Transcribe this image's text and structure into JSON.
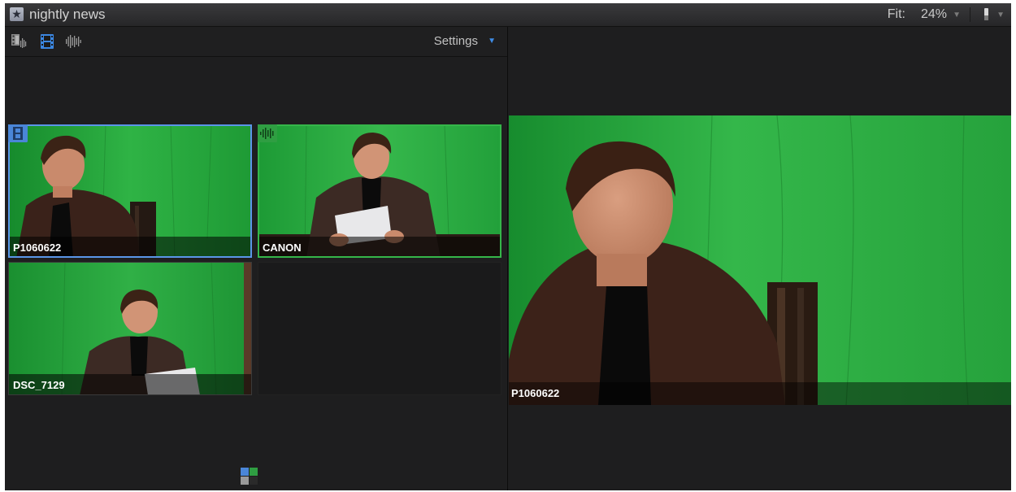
{
  "window": {
    "title": "nightly news",
    "title_icon": "star-icon"
  },
  "viewer_controls": {
    "fit_label": "Fit:",
    "fit_value": "24%",
    "view_options_icon": "viewer-display-icon"
  },
  "angle_viewer": {
    "toolbar": {
      "icons": [
        "video-audio-switch-icon",
        "video-only-switch-icon",
        "audio-only-switch-icon"
      ],
      "settings_label": "Settings"
    },
    "angles": [
      {
        "label": "P1060622",
        "active_badge": "film-icon",
        "border_color": "#5a96e8"
      },
      {
        "label": "CANON",
        "active_badge": "waveform-icon",
        "border_color": "#35b64a"
      },
      {
        "label": "DSC_7129"
      }
    ],
    "bank_icon": "angle-bank-icon"
  },
  "viewer": {
    "clip_label": "P1060622"
  },
  "colors": {
    "video_active": "#5a96e8",
    "audio_active": "#35b64a",
    "green_screen": "#1f9a35"
  }
}
